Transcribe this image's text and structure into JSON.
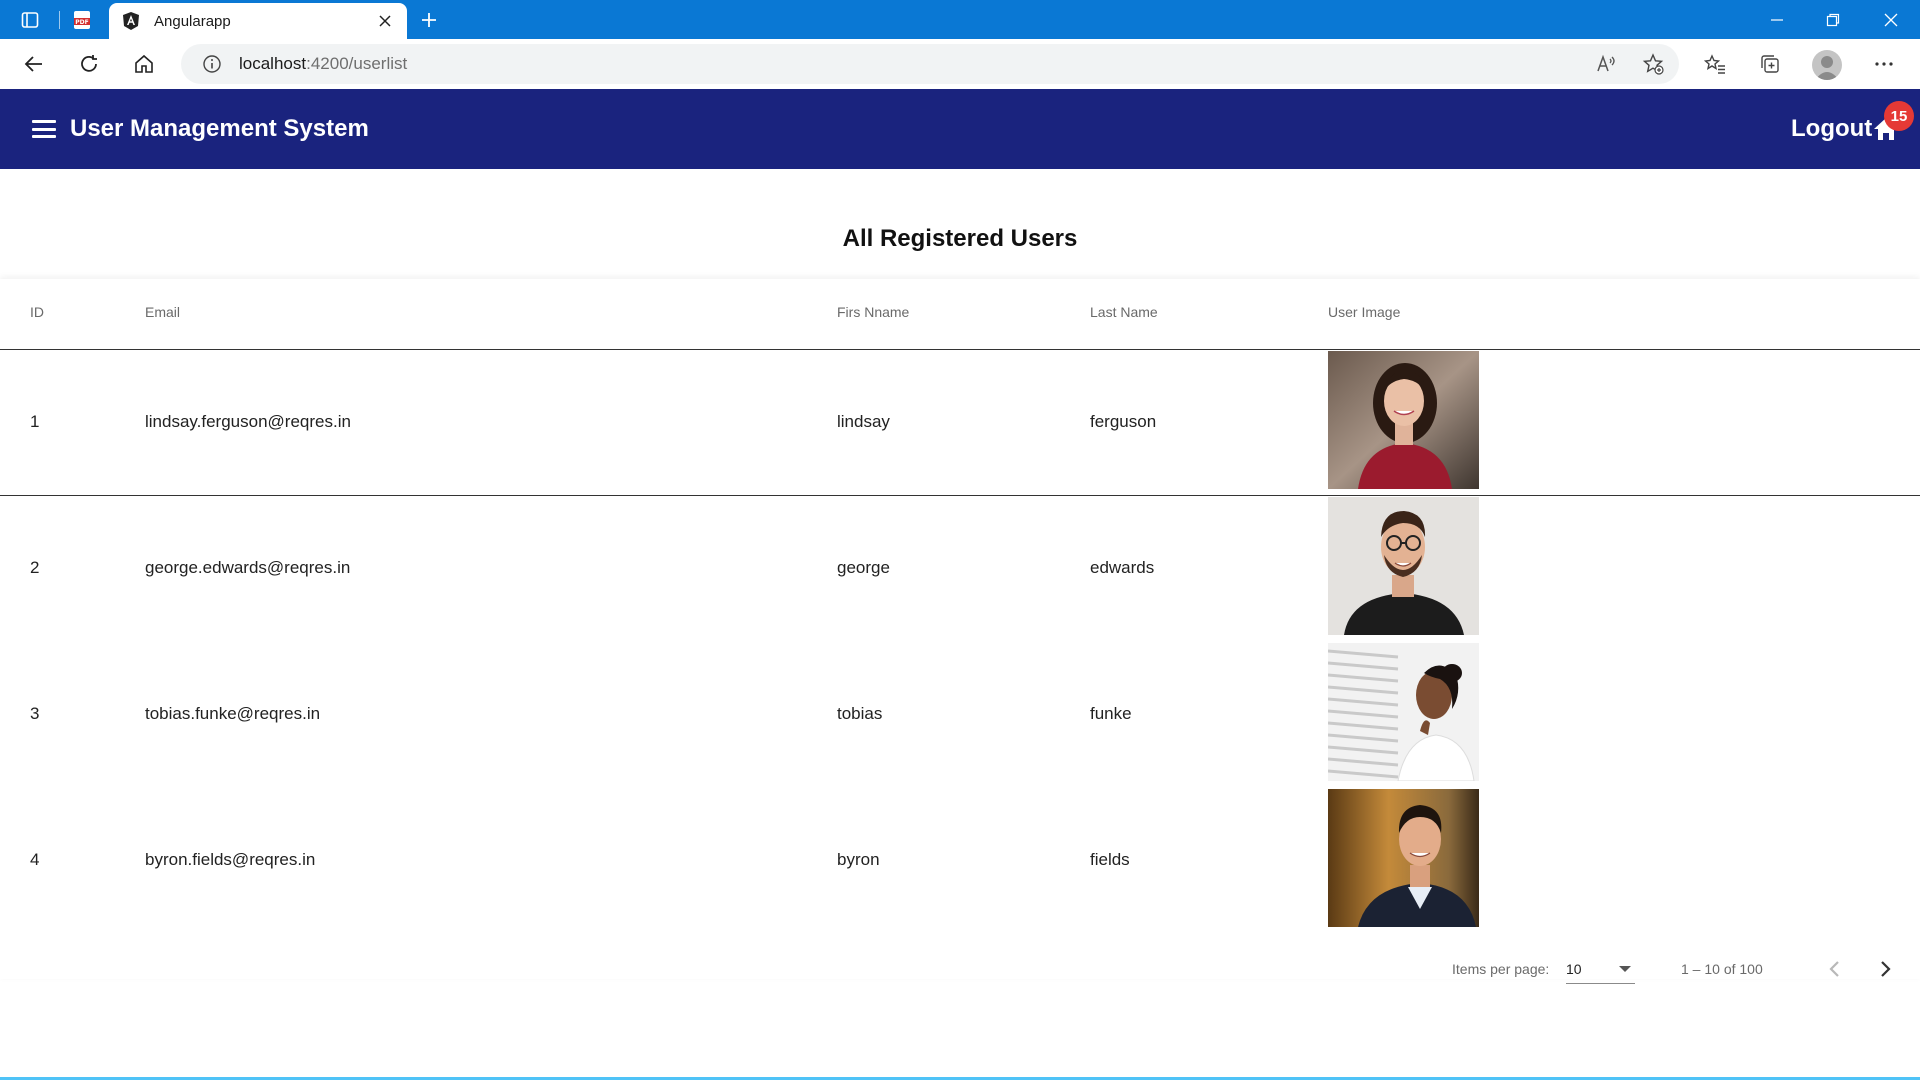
{
  "browser": {
    "tab_title": "Angularapp",
    "url_host": "localhost",
    "url_rest": ":4200/userlist",
    "accent": "#0a78d4"
  },
  "header": {
    "title": "User Management System",
    "logout_label": "Logout",
    "badge_count": "15",
    "background": "#1a237e",
    "badge_color": "#e53935"
  },
  "main": {
    "page_title": "All Registered Users"
  },
  "table": {
    "columns": [
      "ID",
      "Email",
      "Firs Nname",
      "Last Name",
      "User Image"
    ],
    "rows": [
      {
        "id": "1",
        "email": "lindsay.ferguson@reqres.in",
        "first_name": "lindsay",
        "last_name": "ferguson",
        "image": "portrait-woman-red-top"
      },
      {
        "id": "2",
        "email": "george.edwards@reqres.in",
        "first_name": "george",
        "last_name": "edwards",
        "image": "portrait-man-glasses-black-tshirt"
      },
      {
        "id": "3",
        "email": "tobias.funke@reqres.in",
        "first_name": "tobias",
        "last_name": "funke",
        "image": "portrait-woman-window-white-shirt"
      },
      {
        "id": "4",
        "email": "byron.fields@reqres.in",
        "first_name": "byron",
        "last_name": "fields",
        "image": "portrait-man-dark-blazer"
      }
    ]
  },
  "paginator": {
    "items_per_page_label": "Items per page:",
    "items_per_page_value": "10",
    "range_label": "1 – 10 of 100"
  }
}
